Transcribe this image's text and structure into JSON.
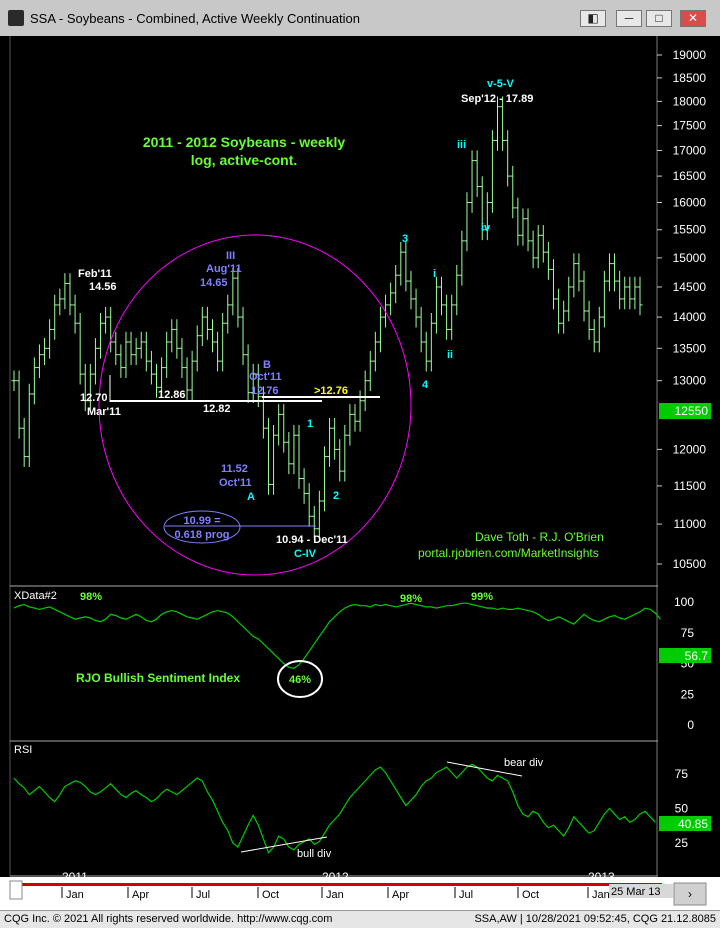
{
  "window": {
    "title": "SSA - Soybeans - Combined, Active Weekly Continuation",
    "buttons": {
      "restore": "◧",
      "minimize": "─",
      "maximize": "□",
      "close": "✕"
    }
  },
  "footer": {
    "left": "CQG Inc. © 2021 All rights reserved worldwide. http://www.cqg.com",
    "right": "SSA,AW | 10/28/2021 09:52:45, CQG 21.12.8085"
  },
  "colors": {
    "bg": "#000000",
    "bars": "#9cff9c",
    "annot": "#8080ff",
    "wave": "#00ffff",
    "circle": "#ff00ff",
    "label_green": "#66ff33",
    "price_tag": "#00cc00",
    "white": "#ffffff",
    "year_bar": "#cc0000"
  },
  "chart_data": [
    {
      "type": "ohlc",
      "title": "2011 - 2012 Soybeans - weekly",
      "subtitle": "log, active-cont.",
      "scale": "log",
      "ylim": [
        10.2,
        19.2
      ],
      "y_ticks": [
        "19000",
        "18500",
        "18000",
        "17500",
        "17000",
        "16500",
        "16000",
        "15500",
        "15000",
        "14500",
        "14000",
        "13500",
        "13000",
        "12550",
        "12000",
        "11500",
        "11000",
        "10500"
      ],
      "current_price": "12550",
      "path": [
        13.0,
        12.3,
        11.9,
        12.8,
        13.2,
        13.4,
        13.5,
        13.8,
        14.2,
        14.3,
        14.56,
        14.2,
        13.9,
        13.1,
        12.7,
        13.1,
        13.5,
        13.9,
        14.0,
        13.6,
        13.4,
        13.2,
        13.6,
        13.4,
        13.5,
        13.6,
        13.3,
        13.1,
        12.9,
        13.2,
        13.6,
        13.8,
        13.5,
        13.2,
        12.86,
        13.3,
        13.7,
        14.0,
        13.8,
        13.6,
        13.3,
        13.9,
        14.2,
        14.65,
        14.0,
        13.4,
        12.82,
        13.1,
        12.76,
        12.3,
        11.52,
        12.2,
        12.5,
        12.1,
        11.8,
        12.2,
        11.6,
        11.4,
        11.1,
        10.94,
        11.3,
        11.9,
        12.3,
        12.0,
        11.7,
        12.2,
        12.5,
        12.4,
        12.7,
        13.0,
        13.3,
        13.6,
        14.0,
        14.2,
        14.4,
        14.7,
        15.1,
        14.6,
        14.3,
        14.0,
        13.6,
        13.3,
        13.9,
        14.5,
        14.2,
        13.8,
        14.2,
        14.7,
        15.3,
        16.0,
        16.8,
        16.3,
        15.5,
        16.0,
        17.2,
        17.89,
        17.2,
        16.5,
        15.9,
        15.4,
        15.7,
        15.3,
        15.0,
        15.4,
        15.1,
        14.8,
        14.3,
        13.9,
        14.1,
        14.5,
        14.9,
        14.6,
        14.1,
        13.8,
        13.6,
        14.0,
        14.6,
        14.9,
        14.6,
        14.3,
        14.5,
        14.3,
        14.5,
        14.2
      ],
      "annotations": [
        {
          "text": "Feb'11"
        },
        {
          "text": "14.56"
        },
        {
          "text": "III"
        },
        {
          "text": "Aug'11"
        },
        {
          "text": "14.65"
        },
        {
          "text": "12.70"
        },
        {
          "text": "Mar'11"
        },
        {
          "text": "12.86"
        },
        {
          "text": "12.82"
        },
        {
          "text": "B"
        },
        {
          "text": "Oct'11"
        },
        {
          "text": "12.76"
        },
        {
          "text": ">12.76"
        },
        {
          "text": "11.52"
        },
        {
          "text": "Oct'11"
        },
        {
          "text": "A"
        },
        {
          "text": "10.99 ="
        },
        {
          "text": "0.618 prog"
        },
        {
          "text": "10.94 - Dec'11"
        },
        {
          "text": "C-IV"
        },
        {
          "text": "1"
        },
        {
          "text": "2"
        },
        {
          "text": "3"
        },
        {
          "text": "4"
        },
        {
          "text": "i"
        },
        {
          "text": "ii"
        },
        {
          "text": "iii"
        },
        {
          "text": "iv"
        },
        {
          "text": "v-5-V"
        },
        {
          "text": "Sep'12 - 17.89"
        }
      ],
      "credit": [
        "Dave Toth - R.J. O'Brien",
        "portal.rjobrien.com/MarketInsights"
      ]
    },
    {
      "type": "line",
      "panel_label": "XData#2",
      "series_label": "RJO Bullish Sentiment Index",
      "ylim": [
        0,
        100
      ],
      "y_ticks": [
        "100",
        "75",
        "50",
        "25",
        "0"
      ],
      "current_value": "56.7",
      "callouts": [
        "98%",
        "46%",
        "98%",
        "99%"
      ],
      "values": [
        95,
        97,
        98,
        96,
        95,
        94,
        95,
        96,
        94,
        92,
        90,
        88,
        86,
        87,
        88,
        87,
        85,
        84,
        86,
        90,
        89,
        87,
        86,
        88,
        90,
        88,
        85,
        84,
        86,
        90,
        92,
        93,
        92,
        90,
        88,
        87,
        86,
        88,
        90,
        92,
        93,
        92,
        91,
        88,
        84,
        80,
        76,
        72,
        70,
        66,
        62,
        58,
        54,
        50,
        47,
        46,
        49,
        54,
        60,
        66,
        72,
        78,
        84,
        88,
        92,
        95,
        97,
        98,
        97,
        97,
        96,
        98,
        97,
        98,
        97,
        96,
        97,
        98,
        99,
        98,
        97,
        96,
        96,
        95,
        96,
        97,
        97,
        98,
        99,
        99,
        98,
        97,
        96,
        95,
        95,
        94,
        95,
        94,
        94,
        95,
        94,
        93,
        92,
        90,
        87,
        85,
        86,
        88,
        86,
        84,
        82,
        86,
        90,
        87,
        85,
        84,
        86,
        88,
        89,
        87,
        86,
        88,
        90,
        92,
        95,
        94,
        91,
        86
      ]
    },
    {
      "type": "line",
      "panel_label": "RSI",
      "y_ticks": [
        "75",
        "50",
        "25"
      ],
      "current_value": "40.85",
      "callouts": [
        "bull div",
        "bear div"
      ],
      "values": [
        72,
        68,
        65,
        60,
        63,
        66,
        62,
        58,
        55,
        60,
        66,
        68,
        70,
        69,
        66,
        62,
        60,
        62,
        65,
        68,
        64,
        60,
        58,
        61,
        63,
        60,
        58,
        55,
        57,
        61,
        64,
        62,
        60,
        63,
        66,
        69,
        72,
        70,
        62,
        56,
        48,
        40,
        34,
        25,
        22,
        30,
        38,
        45,
        38,
        28,
        18,
        22,
        30,
        28,
        22,
        20,
        24,
        26,
        28,
        24,
        26,
        32,
        38,
        42,
        46,
        52,
        58,
        62,
        66,
        70,
        74,
        78,
        80,
        76,
        70,
        64,
        58,
        52,
        56,
        60,
        66,
        70,
        72,
        76,
        78,
        80,
        76,
        72,
        76,
        80,
        82,
        80,
        76,
        72,
        70,
        74,
        72,
        70,
        62,
        52,
        46,
        44,
        48,
        46,
        40,
        36,
        38,
        34,
        30,
        36,
        44,
        40,
        36,
        32,
        34,
        40,
        46,
        50,
        46,
        42,
        44,
        40,
        42,
        46,
        48,
        44,
        40
      ]
    }
  ],
  "x_axis": {
    "months": [
      "Jan",
      "Apr",
      "Jul",
      "Oct",
      "Jan",
      "Apr",
      "Jul",
      "Oct",
      "Jan"
    ],
    "years": [
      "2011",
      "2012",
      "2013"
    ],
    "cursor_date": "25 Mar 13"
  }
}
